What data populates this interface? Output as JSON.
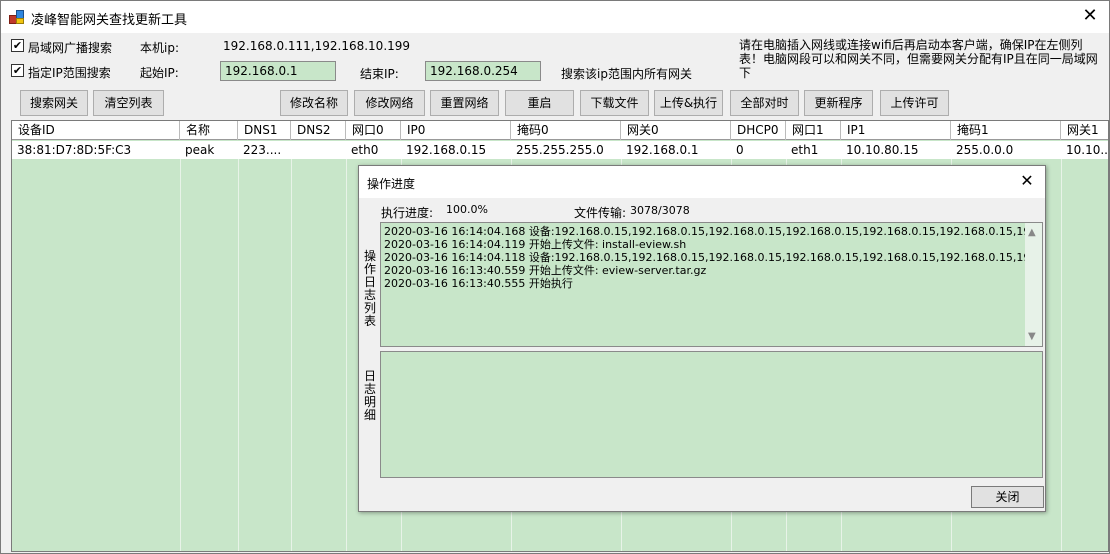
{
  "window": {
    "title": "凌峰智能网关查找更新工具"
  },
  "options": {
    "broadcast_label": "局域网广播搜索",
    "broadcast_checked": "✔",
    "range_label": "指定IP范围搜索",
    "range_checked": "✔",
    "local_ip_label": "本机ip:",
    "local_ip_value": "192.168.0.111,192.168.10.199",
    "start_ip_label": "起始IP:",
    "start_ip_value": "192.168.0.1",
    "end_ip_label": "结束IP:",
    "end_ip_value": "192.168.0.254",
    "range_hint": "搜索该ip范围内所有网关",
    "note": "请在电脑插入网线或连接wifi后再启动本客户端，确保IP在左侧列表！电脑网段可以和网关不同，但需要网关分配有IP且在同一局域网下"
  },
  "toolbar": {
    "search": "搜索网关",
    "clear": "清空列表",
    "rename": "修改名称",
    "edit_network": "修改网络",
    "reset_network": "重置网络",
    "reboot": "重启",
    "download": "下载文件",
    "upload_exec": "上传&执行",
    "sync_time": "全部对时",
    "update": "更新程序",
    "upload_license": "上传许可"
  },
  "table": {
    "headers": [
      "设备ID",
      "名称",
      "DNS1",
      "DNS2",
      "网口0",
      "IP0",
      "掩码0",
      "网关0",
      "DHCP0",
      "网口1",
      "IP1",
      "掩码1",
      "网关1"
    ],
    "rows": [
      [
        "38:81:D7:8D:5F:C3",
        "peak",
        "223....",
        "",
        "eth0",
        "192.168.0.15",
        "255.255.255.0",
        "192.168.0.1",
        "0",
        "eth1",
        "10.10.80.15",
        "255.0.0.0",
        "10.10..."
      ]
    ]
  },
  "dialog": {
    "title": "操作进度",
    "progress_label": "执行进度:",
    "progress_value": "100.0%",
    "transfer_label": "文件传输:",
    "transfer_value": "3078/3078",
    "log_list_label": "操作日志列表",
    "log_detail_label": "日志明细",
    "log_lines": [
      "2020-03-16 16:14:04.168  设备:192.168.0.15,192.168.0.15,192.168.0.15,192.168.0.15,192.168.0.15,192.168.0.15,192.168.0.1",
      "2020-03-16 16:14:04.119  开始上传文件: install-eview.sh",
      "2020-03-16 16:14:04.118  设备:192.168.0.15,192.168.0.15,192.168.0.15,192.168.0.15,192.168.0.15,192.168.0.15,192.168.0.1",
      "2020-03-16 16:13:40.559  开始上传文件: eview-server.tar.gz",
      "2020-03-16 16:13:40.555  开始执行"
    ],
    "close_label": "关闭"
  }
}
